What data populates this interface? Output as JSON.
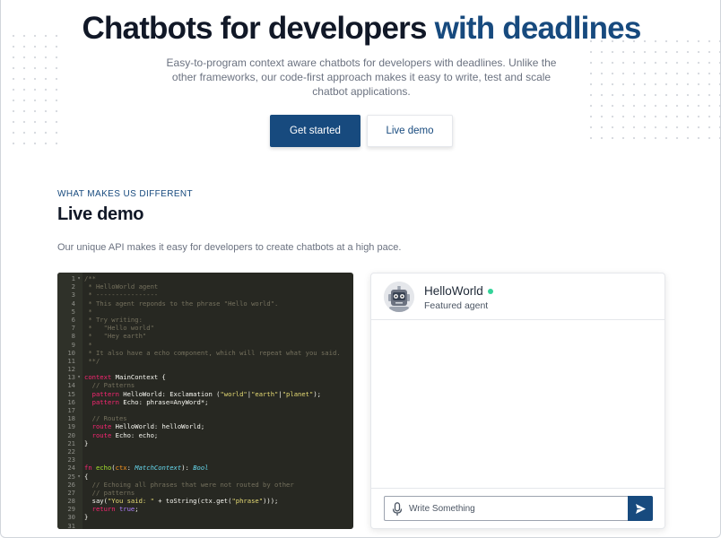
{
  "hero": {
    "title_main": "Chatbots for developers ",
    "title_accent": "with deadlines",
    "subtitle": "Easy-to-program context aware chatbots for developers with deadlines. Unlike the other frameworks, our code-first approach makes it easy to write, test and scale chatbot applications.",
    "primary_button": "Get started",
    "secondary_button": "Live demo"
  },
  "section": {
    "eyebrow": "WHAT MAKES US DIFFERENT",
    "title": "Live demo",
    "description": "Our unique API makes it easy for developers to create chatbots at a high pace."
  },
  "editor": {
    "lines": [
      {
        "n": "1",
        "fold": true,
        "code": "/**"
      },
      {
        "n": "2",
        "code": " * HelloWorld agent"
      },
      {
        "n": "3",
        "code": " * ----------------"
      },
      {
        "n": "4",
        "code": " * This agent reponds to the phrase \"Hello world\"."
      },
      {
        "n": "5",
        "code": " *"
      },
      {
        "n": "6",
        "code": " * Try writing:"
      },
      {
        "n": "7",
        "code": " *   \"Hello world\""
      },
      {
        "n": "8",
        "code": " *   \"Hey earth\""
      },
      {
        "n": "9",
        "code": " *"
      },
      {
        "n": "10",
        "code": " * It also have a echo component, which will repeat what you said."
      },
      {
        "n": "11",
        "code": " **/"
      },
      {
        "n": "12",
        "code": ""
      },
      {
        "n": "13",
        "fold": true,
        "code": "context MainContext {"
      },
      {
        "n": "14",
        "code": "  // Patterns"
      },
      {
        "n": "15",
        "code": "  pattern HelloWorld: Exclamation (\"world\"|\"earth\"|\"planet\");"
      },
      {
        "n": "16",
        "code": "  pattern Echo: phrase=AnyWord*;"
      },
      {
        "n": "17",
        "code": ""
      },
      {
        "n": "18",
        "code": "  // Routes"
      },
      {
        "n": "19",
        "code": "  route HelloWorld: helloWorld;"
      },
      {
        "n": "20",
        "code": "  route Echo: echo;"
      },
      {
        "n": "21",
        "code": "}"
      },
      {
        "n": "22",
        "code": ""
      },
      {
        "n": "23",
        "code": ""
      },
      {
        "n": "24",
        "code": "fn echo(ctx: MatchContext): Bool"
      },
      {
        "n": "25",
        "fold": true,
        "code": "{"
      },
      {
        "n": "26",
        "code": "  // Echoing all phrases that were not routed by other"
      },
      {
        "n": "27",
        "code": "  // patterns"
      },
      {
        "n": "28",
        "code": "  say(\"You said: \" + toString(ctx.get(\"phrase\")));"
      },
      {
        "n": "29",
        "code": "  return true;"
      },
      {
        "n": "30",
        "code": "}"
      },
      {
        "n": "31",
        "code": ""
      }
    ]
  },
  "chat": {
    "agent_name": "HelloWorld",
    "agent_role": "Featured agent",
    "input_placeholder": "Write Something",
    "avatar_icon": "robot-icon",
    "mic_icon": "microphone-icon",
    "send_icon": "send-icon",
    "status_color": "#34d399"
  },
  "colors": {
    "accent": "#174a7e",
    "editor_bg": "#272822"
  }
}
